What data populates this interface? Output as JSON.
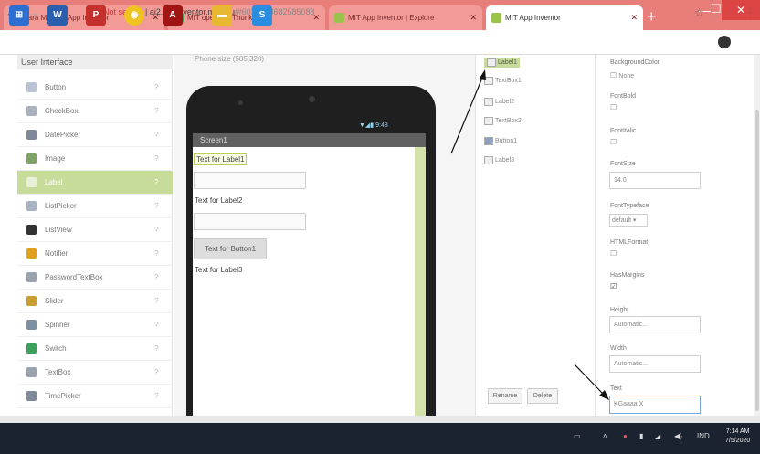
{
  "browser": {
    "tabs": [
      {
        "title": "Cara Menulis App Inventor"
      },
      {
        "title": "MIT open out Thunkable"
      },
      {
        "title": "MIT App Inventor | Explore"
      },
      {
        "title": "MIT App Inventor"
      }
    ],
    "new_tab": "+",
    "security": "Not secure",
    "url_host": "ai2.appinventor.mit.edu",
    "url_rest": "/#6030978682585088"
  },
  "palette": {
    "header": "User Interface",
    "help_glyph": "?",
    "items": [
      {
        "label": "Button",
        "icon": "button-icon",
        "color": "#b8c4d6"
      },
      {
        "label": "CheckBox",
        "icon": "checkbox-icon",
        "color": "#a9b3bf"
      },
      {
        "label": "DatePicker",
        "icon": "datepicker-icon",
        "color": "#7e8a99"
      },
      {
        "label": "Image",
        "icon": "image-icon",
        "color": "#7fa364"
      },
      {
        "label": "Label",
        "icon": "label-icon",
        "color": "#e9f0d8"
      },
      {
        "label": "ListPicker",
        "icon": "listpicker-icon",
        "color": "#a8b4c4"
      },
      {
        "label": "ListView",
        "icon": "listview-icon",
        "color": "#333333"
      },
      {
        "label": "Notifier",
        "icon": "notifier-icon",
        "color": "#e0a020"
      },
      {
        "label": "PasswordTextBox",
        "icon": "password-icon",
        "color": "#9aa3b0"
      },
      {
        "label": "Slider",
        "icon": "slider-icon",
        "color": "#c9a030"
      },
      {
        "label": "Spinner",
        "icon": "spinner-icon",
        "color": "#7f8fa3"
      },
      {
        "label": "Switch",
        "icon": "switch-icon",
        "color": "#3aa05a"
      },
      {
        "label": "TextBox",
        "icon": "textbox-icon",
        "color": "#9aa3b0"
      },
      {
        "label": "TimePicker",
        "icon": "timepicker-icon",
        "color": "#7e8a99"
      }
    ]
  },
  "viewer": {
    "screen_size": "Phone size (505,320)",
    "status_time": "▼◢▮ 9:48",
    "screen_title": "Screen1",
    "label1": "Text for Label1",
    "label2": "Text for Label2",
    "button1": "Text for Button1",
    "label3": "Text for Label3"
  },
  "components": {
    "items": [
      "Label1",
      "TextBox1",
      "Label2",
      "TextBox2",
      "Button1",
      "Label3"
    ],
    "rename": "Rename",
    "delete": "Delete"
  },
  "properties": {
    "background_color_label": "BackgroundColor",
    "background_color_value": "None",
    "fontbold_label": "FontBold",
    "fontitalic_label": "FontItalic",
    "fontsize_label": "FontSize",
    "fontsize_value": "14.0",
    "fonttypeface_label": "FontTypeface",
    "fonttypeface_value": "default ▾",
    "htmlformat_label": "HTMLFormat",
    "hasmargins_label": "HasMargins",
    "height_label": "Height",
    "height_value": "Automatic...",
    "width_label": "Width",
    "width_value": "Automatic...",
    "text_label": "Text",
    "text_value": "KGaaaa X",
    "check_empty": "☐",
    "check_on": "☑"
  },
  "taskbar": {
    "tray_lang": "IND",
    "time": "7:14 AM",
    "date": "7/5/2020"
  },
  "colors": {
    "tab_strip": "#e87e7a",
    "selection": "#c7dc9a",
    "taskbar": "#1b2230"
  }
}
